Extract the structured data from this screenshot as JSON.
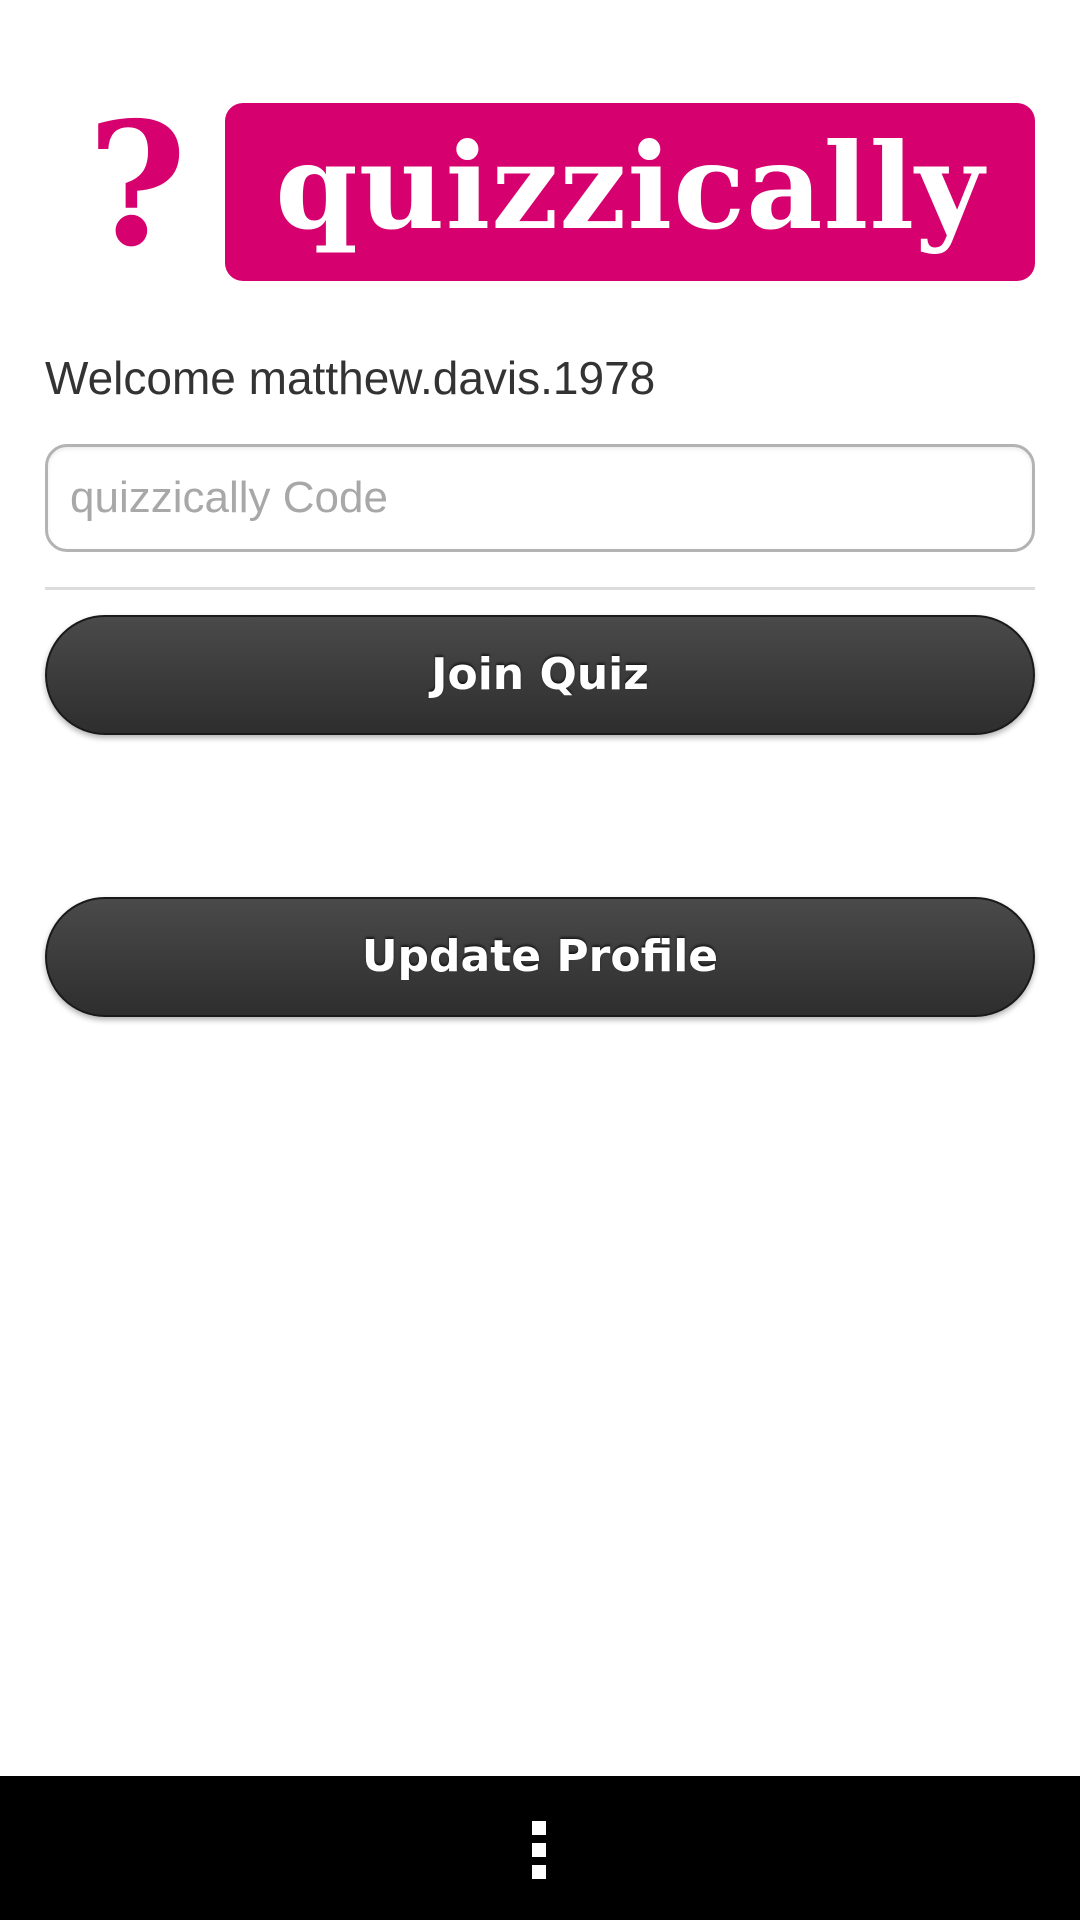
{
  "header": {
    "logo_mark": "?",
    "logo_text": "quizzically"
  },
  "welcome_text": "Welcome matthew.davis.1978",
  "code_input": {
    "value": "",
    "placeholder": "quizzically Code"
  },
  "buttons": {
    "join_label": "Join Quiz",
    "profile_label": "Update Profile"
  },
  "navbar": {
    "menu_icon": "overflow-menu-icon"
  },
  "colors": {
    "brand": "#d6006e",
    "button": "#3a3a3a",
    "navbar": "#000000"
  }
}
